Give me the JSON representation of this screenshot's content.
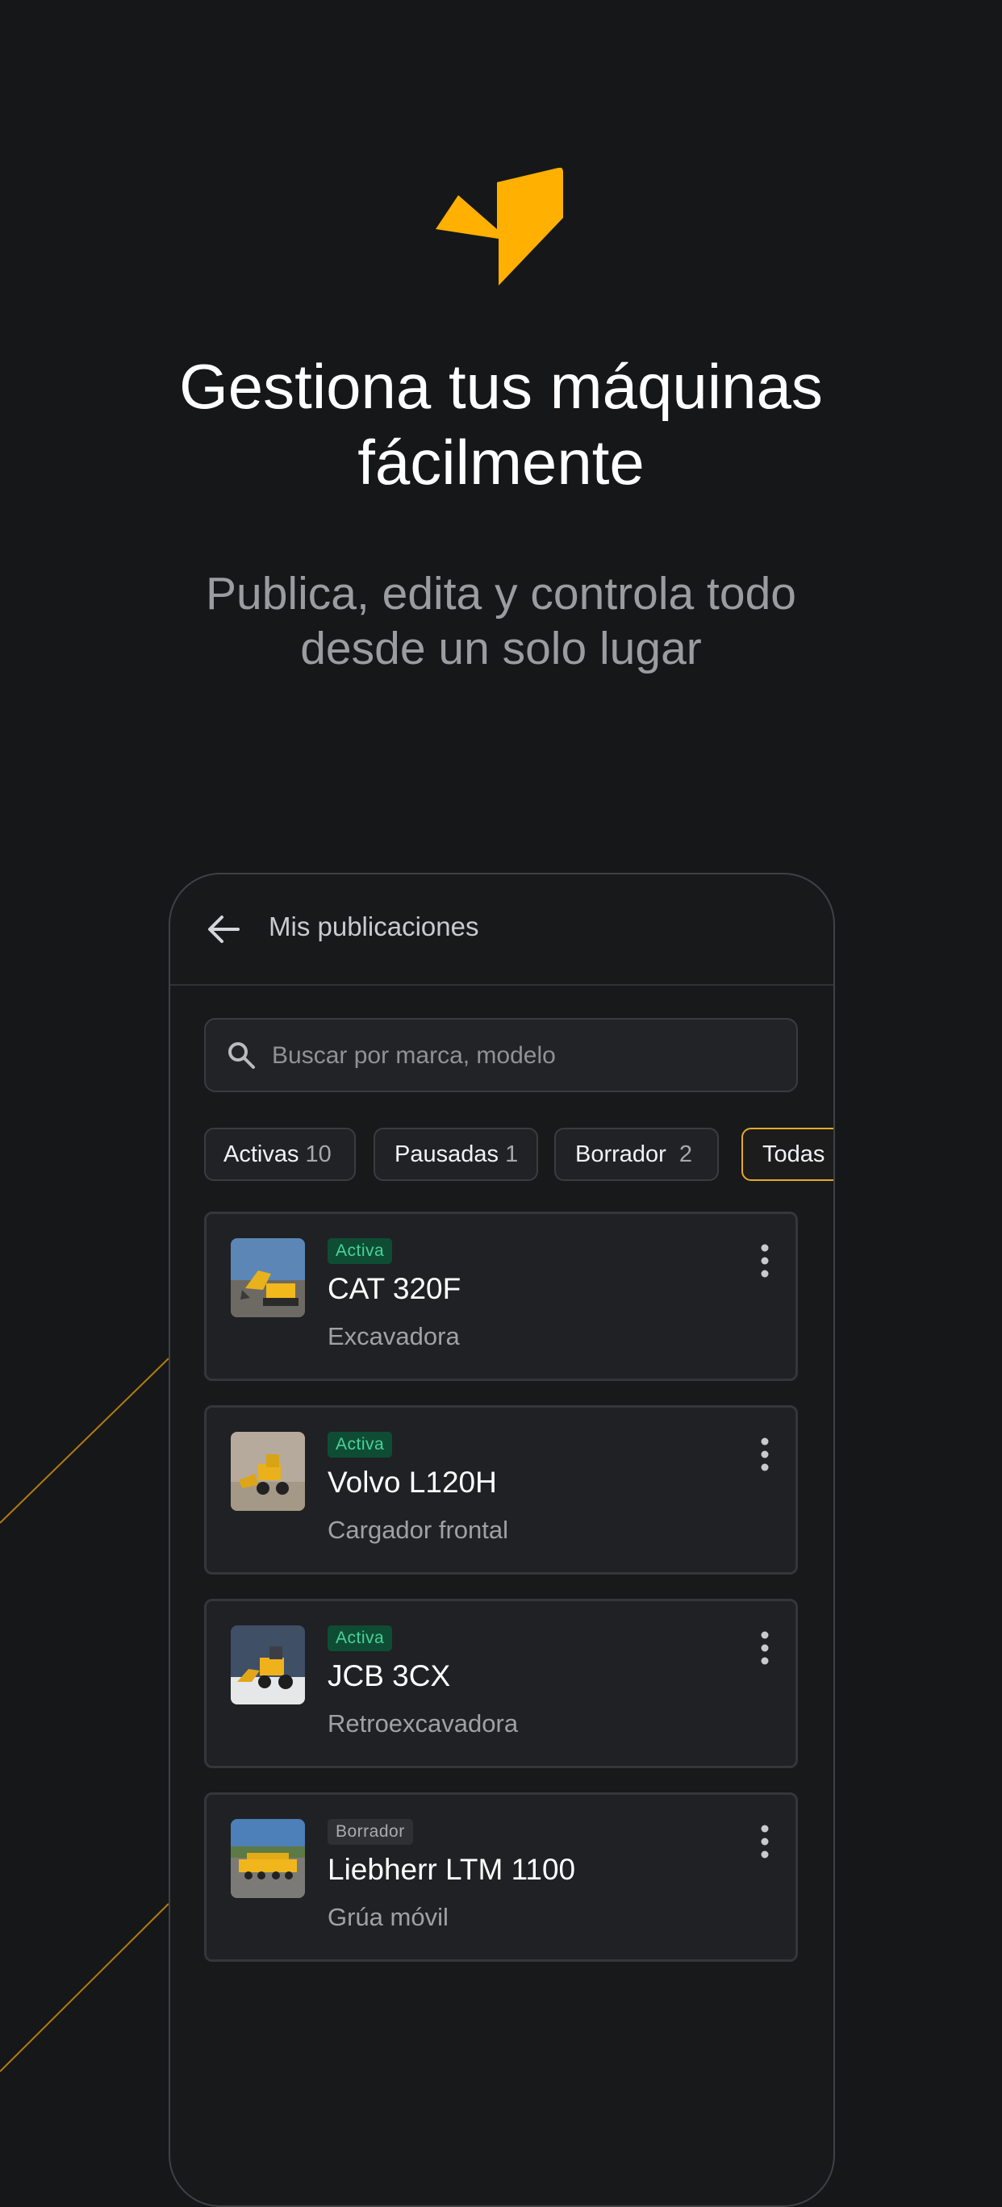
{
  "headline": {
    "line1": "Gestiona tus máquinas",
    "line2": "fácilmente"
  },
  "subline": {
    "line1": "Publica, edita y controla todo",
    "line2": "desde un solo lugar"
  },
  "colors": {
    "accent": "#FFB000",
    "background": "#161719",
    "active_badge": "#0e4d34",
    "active_text": "#46d39a"
  },
  "app": {
    "title": "Mis publicaciones",
    "back_icon": "arrow-left-icon",
    "search": {
      "placeholder": "Buscar por marca, modelo",
      "value": "",
      "icon": "search-icon"
    },
    "filters": [
      {
        "label": "Activas",
        "count": "10",
        "selected": false
      },
      {
        "label": "Pausadas",
        "count": "1",
        "selected": false
      },
      {
        "label": "Borrador",
        "count": "2",
        "selected": false
      },
      {
        "label": "Todas",
        "count": "",
        "selected": true
      }
    ],
    "listings": [
      {
        "status": "Activa",
        "title": "CAT 320F",
        "category": "Excavadora",
        "menu_icon": "more-vertical-icon"
      },
      {
        "status": "Activa",
        "title": "Volvo L120H",
        "category": "Cargador frontal",
        "menu_icon": "more-vertical-icon"
      },
      {
        "status": "Activa",
        "title": "JCB 3CX",
        "category": "Retroexcavadora",
        "menu_icon": "more-vertical-icon"
      },
      {
        "status": "Borrador",
        "title": "Liebherr LTM 1100",
        "category": "Grúa móvil",
        "menu_icon": "more-vertical-icon"
      }
    ]
  }
}
